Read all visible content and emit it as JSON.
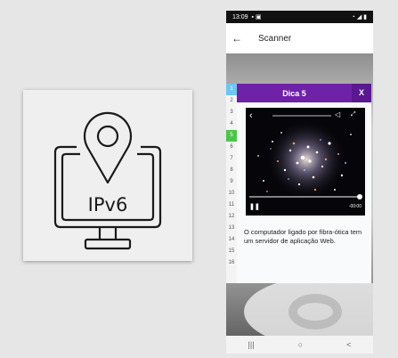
{
  "status_bar": {
    "time": "13:09",
    "notif_icons": "▪ ▣",
    "right_icons": "◔ ◢ ▮"
  },
  "app_bar": {
    "title": "Scanner"
  },
  "left_card": {
    "icon_text": "IPv6"
  },
  "line_numbers": [
    "1",
    "2",
    "3",
    "4",
    "5",
    "6",
    "7",
    "8",
    "9",
    "10",
    "11",
    "12",
    "13",
    "14",
    "15",
    "16"
  ],
  "dica": {
    "title": "Dica 5",
    "close_label": "X",
    "video_time": "-00:00",
    "text": "O computador ligado por fibra-ótica tem um servidor de aplicação Web."
  },
  "nav_bar": {
    "recents": "|||",
    "home": "○",
    "back": "<"
  },
  "colors": {
    "header": "#6f21a8",
    "close": "#5a1890",
    "active_line_1": "#6fc6f0",
    "active_line_5": "#4cc44c"
  }
}
